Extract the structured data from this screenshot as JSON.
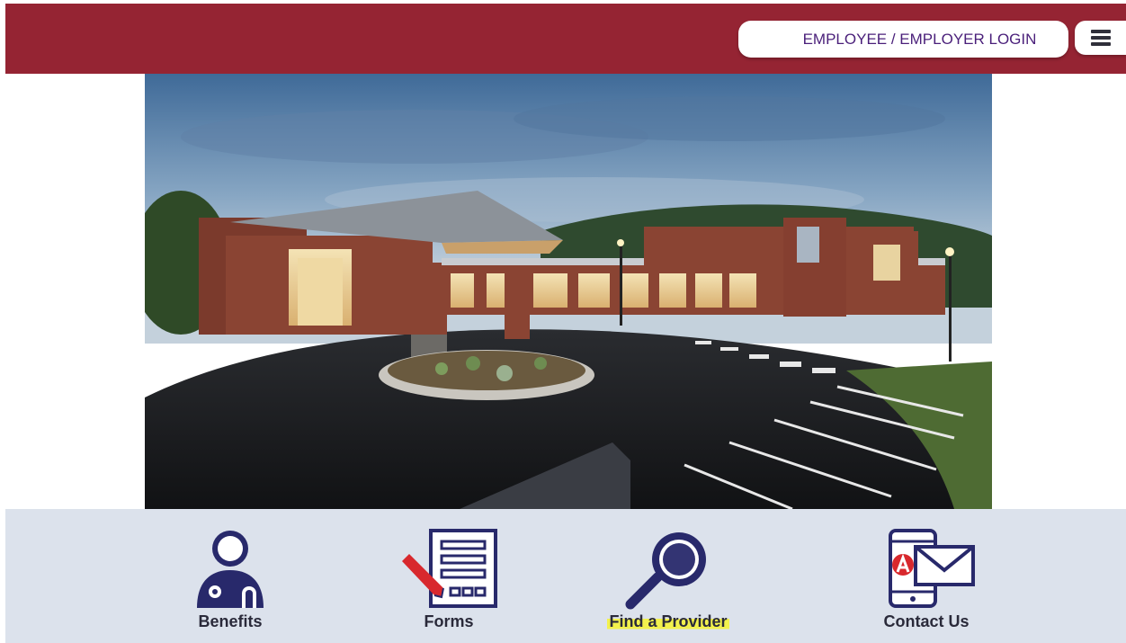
{
  "header": {
    "login_label": "EMPLOYEE / EMPLOYER LOGIN",
    "menu_icon": "hamburger-menu-icon"
  },
  "hero": {
    "image": "photo of a brick hospital building with a covered entrance and a curved driveway at dusk"
  },
  "nav": {
    "items": [
      {
        "label": "Benefits",
        "icon": "doctor-stethoscope-icon"
      },
      {
        "label": "Forms",
        "icon": "document-pencil-icon"
      },
      {
        "label": "Find a Provider",
        "icon": "magnifying-glass-icon",
        "highlighted": true
      },
      {
        "label": "Contact Us",
        "icon": "phone-envelope-icon"
      }
    ]
  },
  "colors": {
    "header_bg": "#952433",
    "nav_bg": "#dce2ec",
    "icon_navy": "#28296b",
    "accent_red": "#d8282d",
    "highlight": "#f2f14d"
  }
}
